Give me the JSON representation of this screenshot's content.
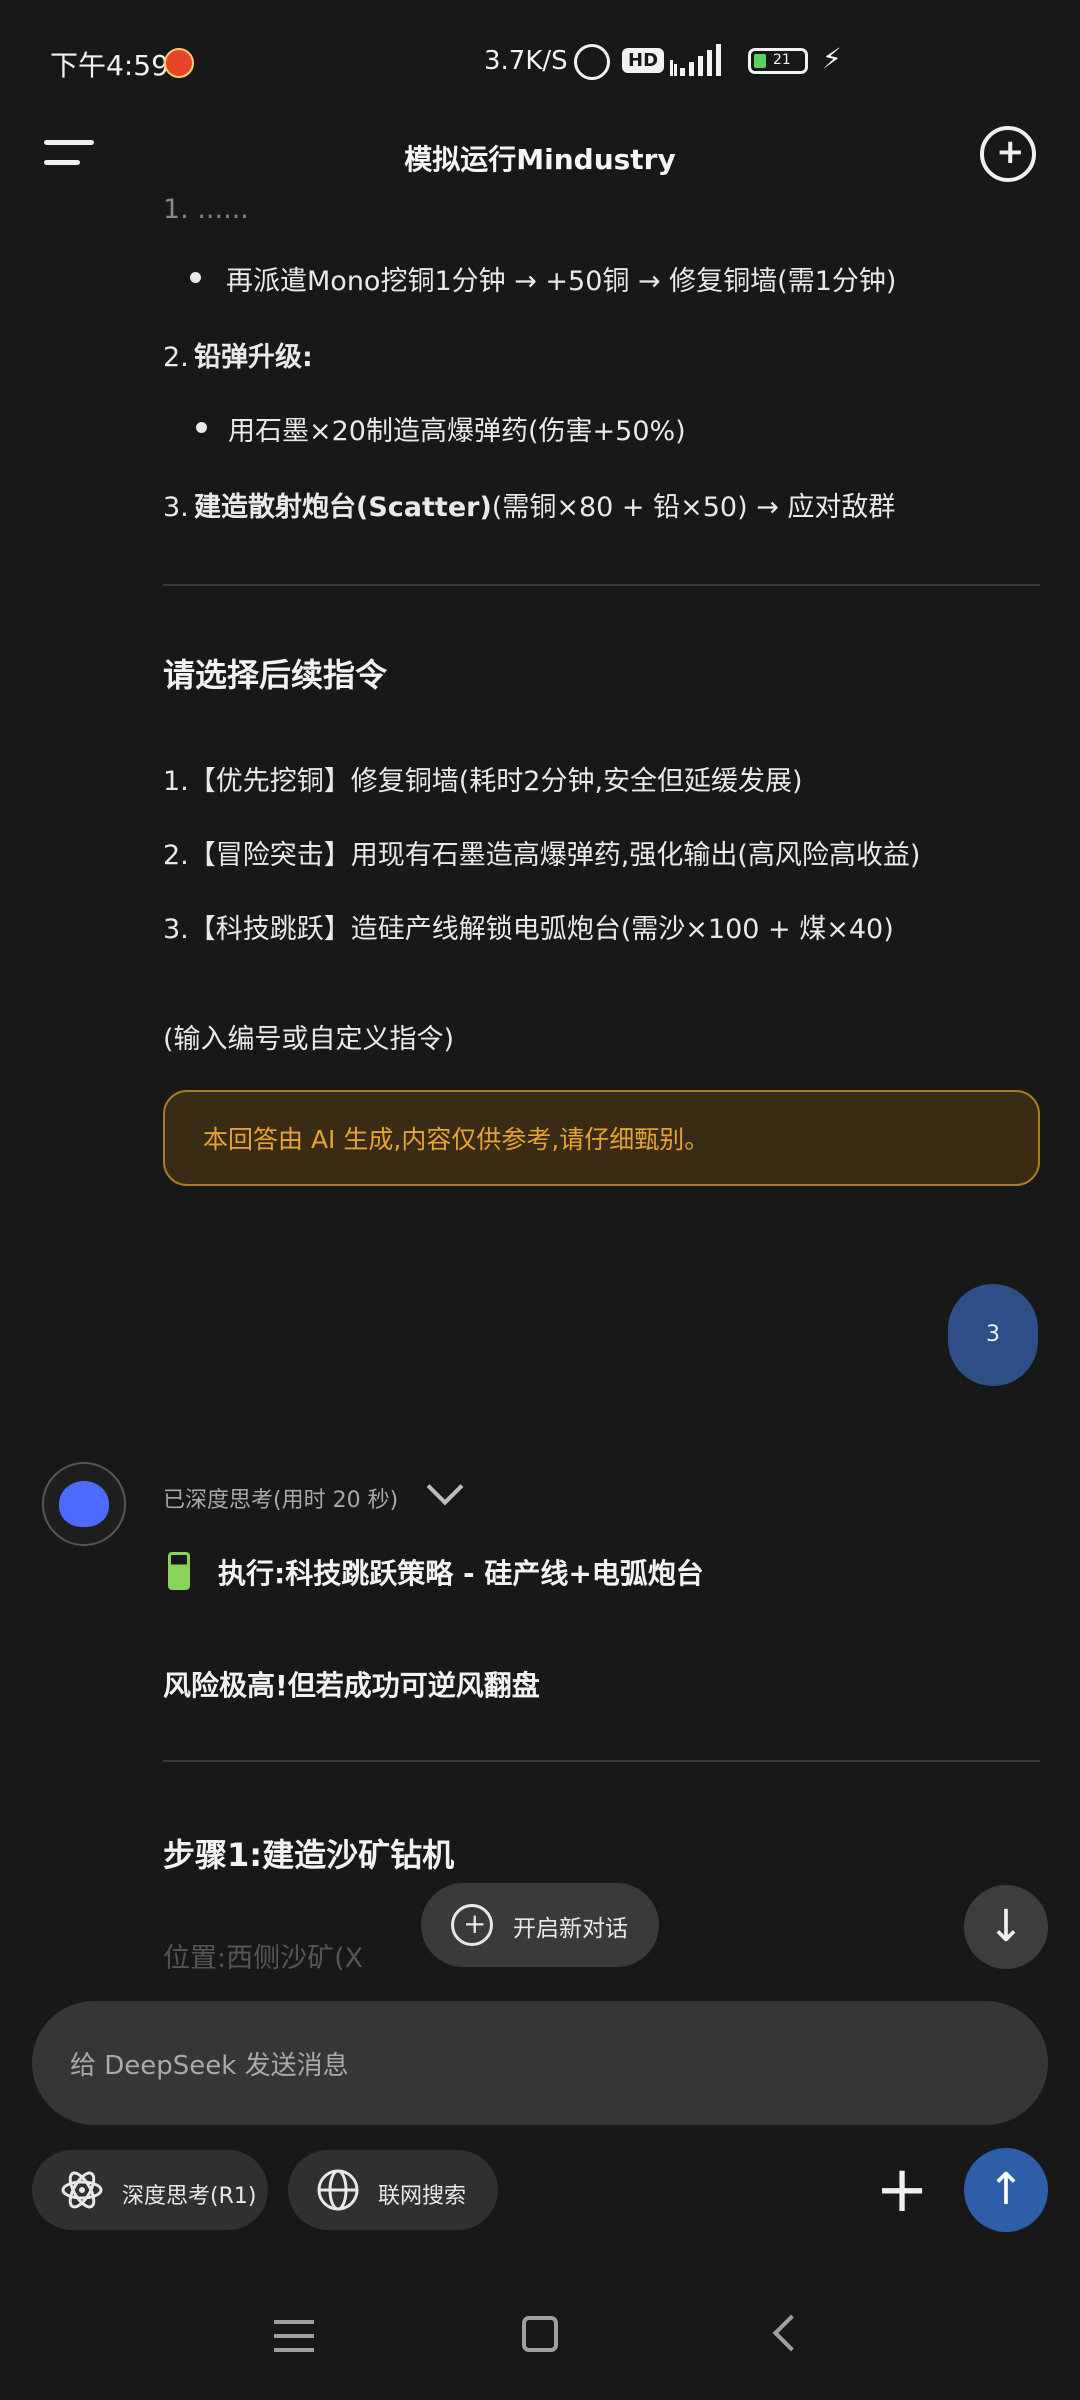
{
  "status_bar": {
    "time": "下午4:59",
    "net_speed": "3.7K/S",
    "hd_badge": "HD",
    "battery_level": "21"
  },
  "header": {
    "title": "模拟运行Mindustry"
  },
  "message_prev": {
    "bullet1": "再派遣Mono挖铜1分钟 → +50铜 → 修复铜墙(需1分钟)",
    "item2_num": "2.",
    "item2_title": "铅弹升级:",
    "bullet2": "用石墨×20制造高爆弹药(伤害+50%)",
    "item3_num": "3.",
    "item3_title": "建造散射炮台(Scatter)",
    "item3_rest": "(需铜×80 + 铅×50) → 应对敌群",
    "section_title": "请选择后续指令",
    "options": [
      "1.【优先挖铜】修复铜墙(耗时2分钟,安全但延缓发展)",
      "2.【冒险突击】用现有石墨造高爆弹药,强化输出(高风险高收益)",
      "3.【科技跳跃】造硅产线解锁电弧炮台(需沙×100 + 煤×40)"
    ],
    "prompt": "(输入编号或自定义指令)",
    "notice": "本回答由 AI 生成,内容仅供参考,请仔细甄别。"
  },
  "user_message": "3",
  "assistant": {
    "think_label": "已深度思考(用时 20 秒)",
    "exec_title": "执行:科技跳跃策略 - 硅产线+电弧炮台",
    "risk_line": "风险极高!但若成功可逆风翻盘",
    "step1_title": "步骤1:建造沙矿钻机",
    "faded_line": "位置:西侧沙矿(X"
  },
  "floating": {
    "new_chat_label": "开启新对话"
  },
  "input": {
    "placeholder": "给 DeepSeek 发送消息"
  },
  "toolbar": {
    "deep_think_label": "深度思考(R1)",
    "web_search_label": "联网搜索"
  }
}
